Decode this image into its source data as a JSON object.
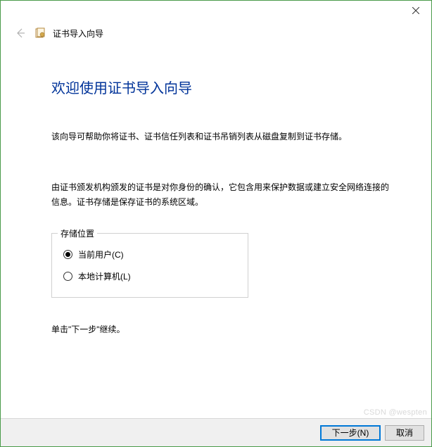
{
  "header": {
    "title": "证书导入向导"
  },
  "main": {
    "heading": "欢迎使用证书导入向导",
    "description1": "该向导可帮助你将证书、证书信任列表和证书吊销列表从磁盘复制到证书存储。",
    "description2": "由证书颁发机构颁发的证书是对你身份的确认，它包含用来保护数据或建立安全网络连接的信息。证书存储是保存证书的系统区域。"
  },
  "storage": {
    "legend": "存储位置",
    "options": {
      "current_user": "当前用户(C)",
      "local_machine": "本地计算机(L)"
    },
    "selected": "current_user"
  },
  "hint": "单击\"下一步\"继续。",
  "footer": {
    "next": "下一步(N)",
    "cancel": "取消"
  },
  "watermark": "CSDN @wespten"
}
